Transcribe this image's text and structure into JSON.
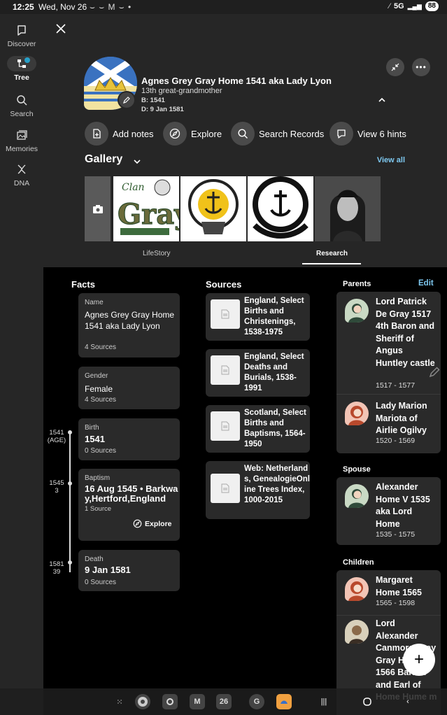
{
  "status_bar": {
    "time": "12:25",
    "date": "Wed, Nov 26",
    "notifications": "⌣ ⌣ M ⌣ •",
    "network": "5G",
    "battery": "88"
  },
  "rail": {
    "items": [
      {
        "label": "Discover",
        "icon": "discover-icon"
      },
      {
        "label": "Tree",
        "icon": "tree-icon"
      },
      {
        "label": "Search",
        "icon": "search-icon"
      },
      {
        "label": "Memories",
        "icon": "memories-icon"
      },
      {
        "label": "DNA",
        "icon": "dna-icon"
      }
    ]
  },
  "profile": {
    "name": "Agnes Grey Gray Home 1541 aka Lady Lyon",
    "relationship": "13th great-grandmother",
    "birth": "B: 1541",
    "death": "D: 9 Jan 1581"
  },
  "actions": [
    {
      "label": "Add notes",
      "icon": "add-note-icon"
    },
    {
      "label": "Explore",
      "icon": "compass-icon"
    },
    {
      "label": "Search Records",
      "icon": "search-icon"
    },
    {
      "label": "View 6 hints",
      "icon": "hint-icon"
    }
  ],
  "gallery": {
    "title": "Gallery",
    "view_all": "View all"
  },
  "tabs": [
    {
      "label": "LifeStory",
      "active": false
    },
    {
      "label": "Research",
      "active": true
    }
  ],
  "facts": {
    "title": "Facts",
    "items": [
      {
        "label": "Name",
        "value": "Agnes Grey Gray Home 1541 aka Lady Lyon",
        "sources": "4 Sources"
      },
      {
        "label": "Gender",
        "value": "Female",
        "sources": "4 Sources"
      },
      {
        "label": "Birth",
        "value": "1541",
        "sources": "0 Sources"
      },
      {
        "label": "Baptism",
        "value": "16 Aug 1545 • Barkway,Hertford,England",
        "sources": "1 Source",
        "action": "Explore"
      },
      {
        "label": "Death",
        "value": "9 Jan 1581",
        "sources": "0 Sources"
      }
    ],
    "timeline": [
      {
        "year": "1541",
        "age": "(AGE)"
      },
      {
        "year": "1545",
        "age": "3"
      },
      {
        "year": "1581",
        "age": "39"
      }
    ]
  },
  "sources": {
    "title": "Sources",
    "items": [
      "England, Select Births and Christenings, 1538-1975",
      "England, Select Deaths and Burials, 1538-1991",
      "Scotland, Select Births and Baptisms, 1564-1950",
      "Web: Netherlands, GenealogieOnline Trees Index, 1000-2015"
    ]
  },
  "relatives": {
    "parents_title": "Parents",
    "edit_label": "Edit",
    "parents": [
      {
        "name": "Lord Patrick De Gray 1517 4th Baron and Sheriff of Angus Huntley castle",
        "dates": "1517 - 1577",
        "gender": "male"
      },
      {
        "name": "Lady Marion Mariota of Airlie Ogilvy",
        "dates": "1520 - 1569",
        "gender": "female"
      }
    ],
    "spouse_title": "Spouse",
    "spouse": [
      {
        "name": "Alexander Home V 1535 aka Lord Home",
        "dates": "1535 - 1575",
        "gender": "male"
      }
    ],
    "children_title": "Children",
    "children": [
      {
        "name": "Margaret Home 1565",
        "dates": "1565 - 1598",
        "gender": "female"
      },
      {
        "name": "Lord Alexander Canmore Gray Gray Home 1566 Barron and Earl of Home Hume m",
        "dates": "",
        "gender": "photo"
      }
    ]
  },
  "fab": "+",
  "colors": {
    "accent": "#7ec8f0",
    "card": "#2a2a2a",
    "background": "#000000",
    "panel": "#262626"
  }
}
